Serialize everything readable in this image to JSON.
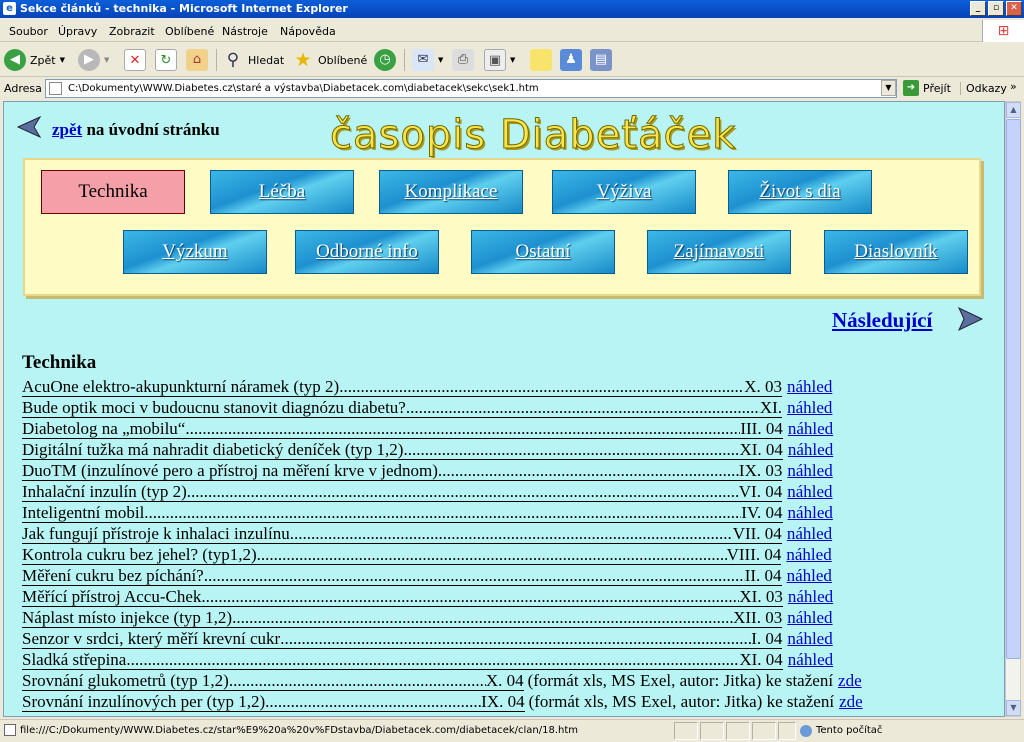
{
  "window": {
    "title": "Sekce článků - technika - Microsoft Internet Explorer"
  },
  "menu": [
    "Soubor",
    "Úpravy",
    "Zobrazit",
    "Oblíbené",
    "Nástroje",
    "Nápověda"
  ],
  "toolbar": {
    "back": "Zpět",
    "search": "Hledat",
    "favorites": "Oblíbené"
  },
  "address": {
    "label": "Adresa",
    "url": "C:\\Dokumenty\\WWW.Diabetes.cz\\staré a výstavba\\Diabetacek.com\\diabetacek\\sekc\\sek1.htm",
    "go": "Přejít",
    "links": "Odkazy"
  },
  "page": {
    "back_link": "zpět",
    "back_text": "na úvodní stránku",
    "logo": "časopis Diabeťáček",
    "nav_row1": [
      "Technika",
      "Léčba",
      "Komplikace",
      "Výživa",
      "Život s dia"
    ],
    "nav_row2": [
      "Výzkum",
      "Odborné info",
      "Ostatní",
      "Zajímavosti",
      "Diaslovník"
    ],
    "next": "Následující",
    "section_title": "Technika",
    "articles": [
      {
        "title": "AcuOne elektro-akupunkturní náramek (typ 2)",
        "date": "X. 03",
        "link": "náhled"
      },
      {
        "title": "Bude optik moci v budoucnu stanovit diagnózu diabetu?",
        "date": "XI.",
        "link": "náhled"
      },
      {
        "title": "Diabetolog na „mobilu“",
        "date": "III. 04",
        "link": "náhled"
      },
      {
        "title": "Digitální tužka má nahradit diabetický deníček (typ 1,2)",
        "date": "XI. 04",
        "link": "náhled"
      },
      {
        "title": "DuoTM (inzulínové pero a přístroj na měření krve v jednom)",
        "date": "IX. 03",
        "link": "náhled"
      },
      {
        "title": "Inhalační inzulín (typ 2)",
        "date": "VI. 04",
        "link": "náhled"
      },
      {
        "title": "Inteligentní mobil",
        "date": "IV. 04",
        "link": "náhled"
      },
      {
        "title": "Jak fungují přístroje k inhalaci inzulínu",
        "date": "VII. 04",
        "link": "náhled"
      },
      {
        "title": "Kontrola cukru bez jehel? (typ1,2)",
        "date": "VIII. 04",
        "link": "náhled"
      },
      {
        "title": "Měření cukru bez píchání?",
        "date": "II. 04",
        "link": "náhled"
      },
      {
        "title": "Měřící přístroj Accu-Chek",
        "date": "XI. 03",
        "link": "náhled"
      },
      {
        "title": "Náplast místo injekce (typ 1,2)",
        "date": "XII. 03",
        "link": "náhled"
      },
      {
        "title": "Senzor v srdci, který měří krevní cukr",
        "date": "I. 04",
        "link": "náhled"
      },
      {
        "title": "Sladká střepina",
        "date": "XI. 04",
        "link": "náhled"
      },
      {
        "title": "Srovnání glukometrů (typ 1,2)",
        "date": "X. 04",
        "extra": "(formát xls, MS Exel, autor: Jitka) ke stažení",
        "link": "zde"
      },
      {
        "title": "Srovnání inzulínových per (typ 1,2)",
        "date": "IX. 04",
        "extra": "(formát xls, MS Exel, autor: Jitka) ke stažení",
        "link": "zde"
      }
    ]
  },
  "status": {
    "text": "file:///C:/Dokumenty/WWW.Diabetes.cz/star%E9%20a%20v%FDstavba/Diabetacek.com/diabetacek/clan/18.htm",
    "zone": "Tento počítač"
  }
}
